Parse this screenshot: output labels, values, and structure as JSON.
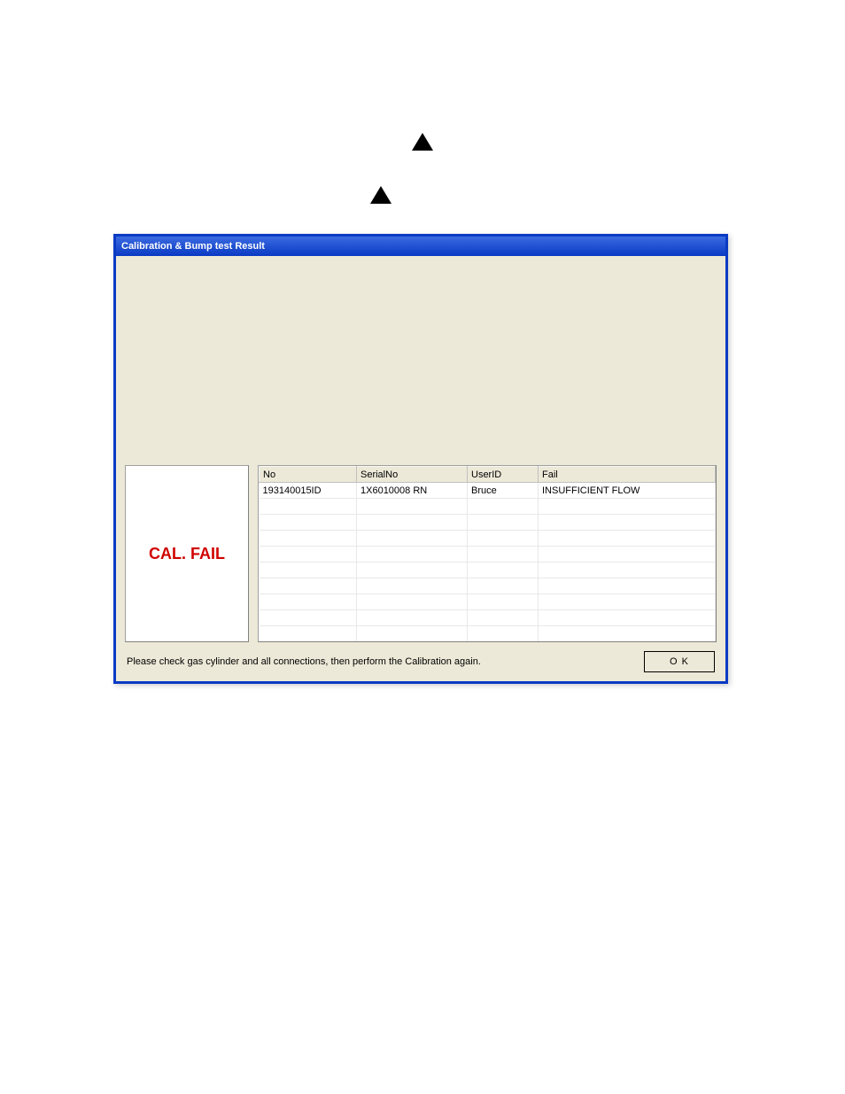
{
  "window": {
    "title": "Calibration & Bump test Result"
  },
  "status": {
    "label": "CAL. FAIL"
  },
  "table": {
    "headers": {
      "no": "No",
      "serial": "SerialNo",
      "user": "UserID",
      "fail": "Fail"
    },
    "rows": [
      {
        "no": "193140015ID",
        "serial": "1X6010008 RN",
        "user": "Bruce",
        "fail": "INSUFFICIENT FLOW"
      }
    ]
  },
  "footer": {
    "message": "Please check gas cylinder and all connections, then perform the Calibration again.",
    "ok_label": "O K"
  }
}
